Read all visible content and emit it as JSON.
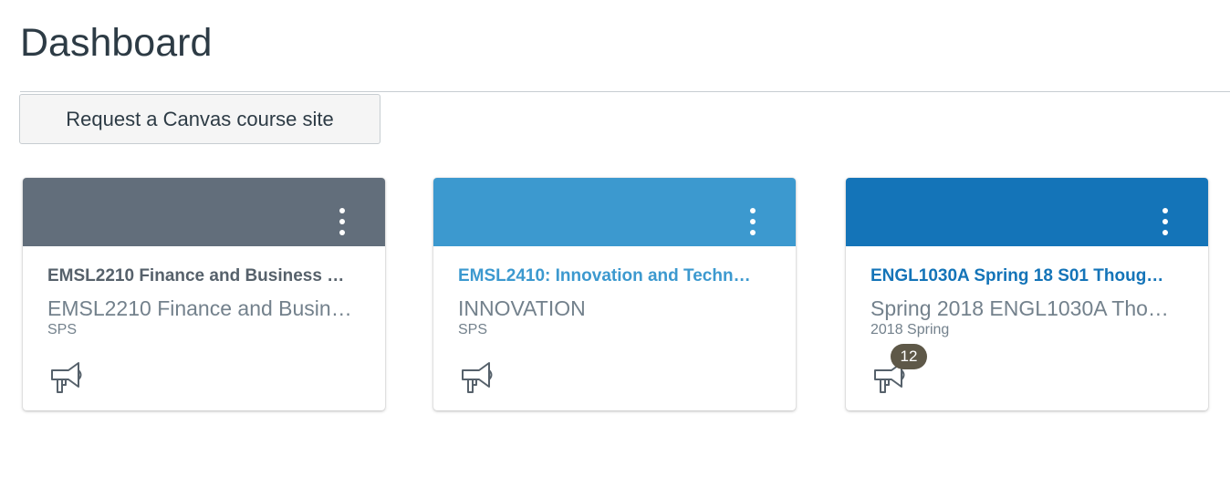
{
  "page": {
    "title": "Dashboard"
  },
  "actions": {
    "request_label": "Request a Canvas course site"
  },
  "colors": {
    "card_1_header": "#626e7b",
    "card_2_header": "#3c99cf",
    "card_3_header": "#1474b8",
    "card_1_title": "#56616b",
    "card_2_title": "#3c99cf",
    "card_3_title": "#1474b8"
  },
  "cards": [
    {
      "title": "EMSL2210 Finance and Business …",
      "subtitle": "EMSL2210 Finance and Busin…",
      "term": "SPS",
      "icons": [
        "more-options-icon",
        "announcements-megaphone-icon"
      ]
    },
    {
      "title": "EMSL2410: Innovation and Techn…",
      "subtitle": "INNOVATION",
      "term": "SPS",
      "icons": [
        "more-options-icon",
        "announcements-megaphone-icon"
      ]
    },
    {
      "title": "ENGL1030A Spring 18 S01 Thoug…",
      "subtitle": "Spring 2018 ENGL1030A Tho…",
      "term": "2018 Spring",
      "unread_count": "12",
      "icons": [
        "more-options-icon",
        "announcements-megaphone-icon"
      ]
    }
  ]
}
